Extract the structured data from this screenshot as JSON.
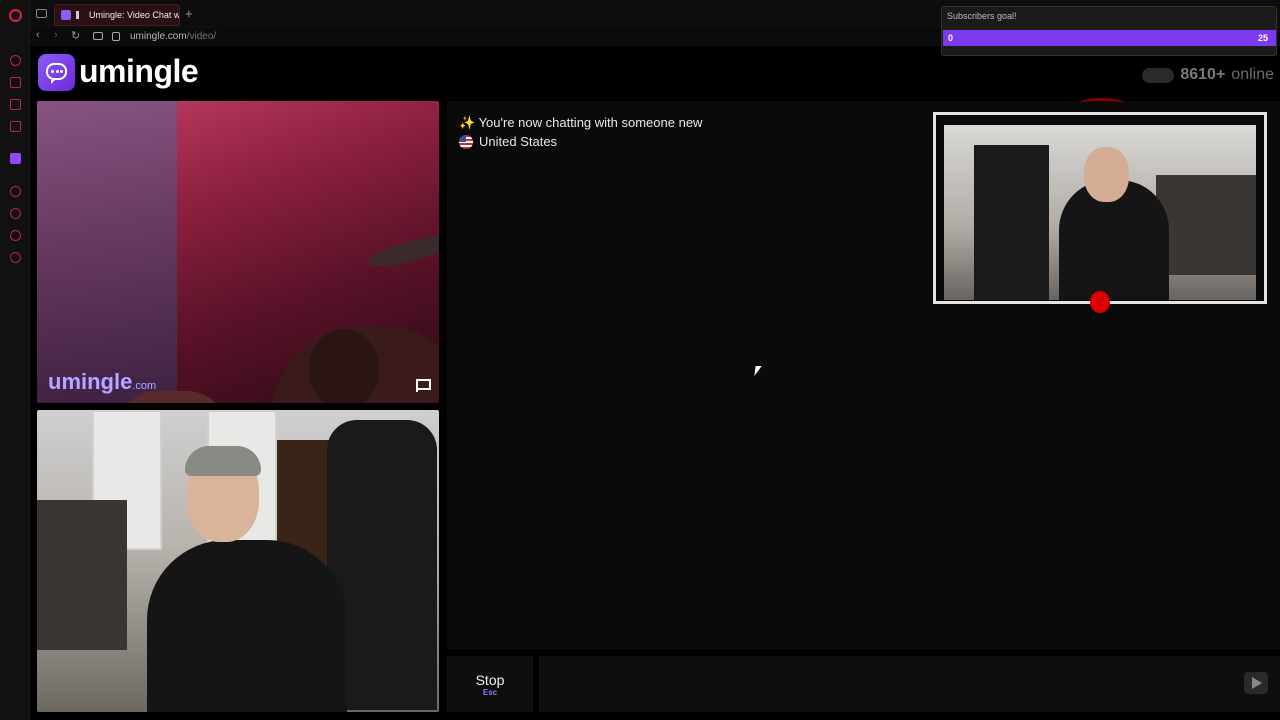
{
  "browser": {
    "tab_title": "Umingle: Video Chat w",
    "new_tab": "+",
    "url_domain": "umingle.com",
    "url_path": "/video/",
    "nav_back": "‹",
    "nav_forward": "›",
    "nav_reload": "↻"
  },
  "goal": {
    "title": "Subscribers goal!",
    "current": "0",
    "target": "25",
    "progress": 0
  },
  "header": {
    "logo_text": "umingle",
    "online_count": "8610+",
    "online_label": "online"
  },
  "video": {
    "watermark": "umingle",
    "watermark_suffix": ".com"
  },
  "chat": {
    "sparkle": "✨",
    "message": "You're now chatting with someone new",
    "country": "United States"
  },
  "controls": {
    "stop_label": "Stop",
    "stop_key": "Esc",
    "message_placeholder": ""
  },
  "colors": {
    "brand": "#8b5cf6",
    "goal_bar": "#7c3aed",
    "browser_accent": "#d8233f"
  }
}
